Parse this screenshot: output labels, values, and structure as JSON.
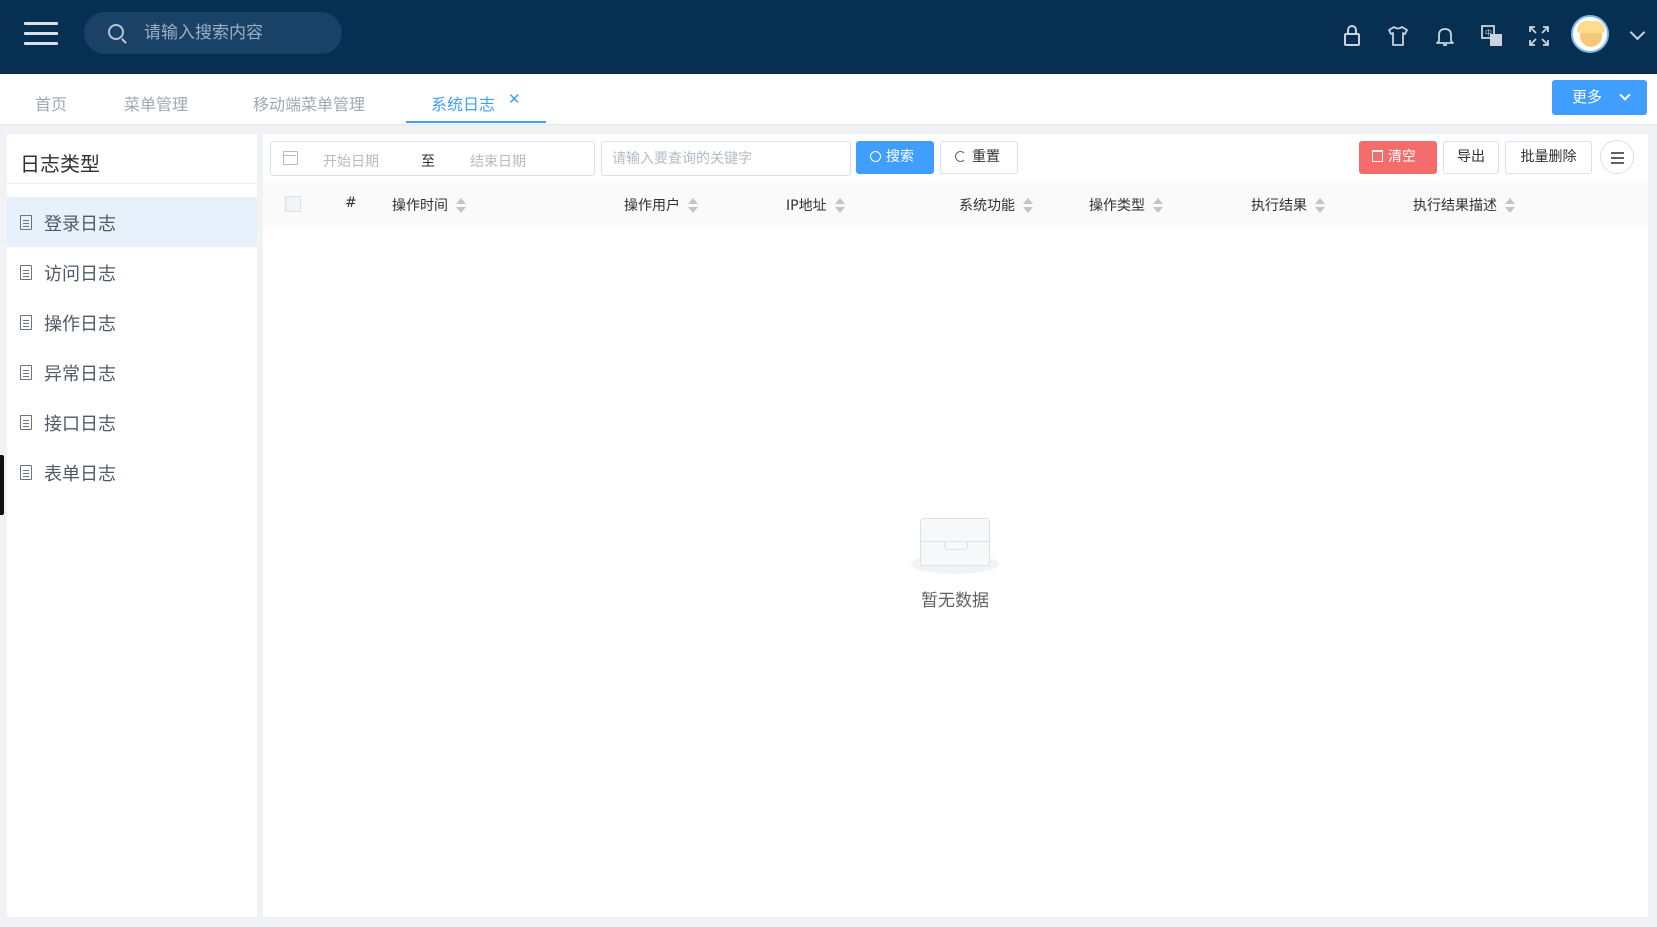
{
  "header": {
    "search_placeholder": "请输入搜索内容",
    "icons": [
      "menu-icon",
      "search-icon",
      "lock-icon",
      "shirt-icon",
      "bell-icon",
      "translate-icon",
      "fullscreen-icon",
      "avatar",
      "chevron-down-icon"
    ]
  },
  "tabs": {
    "items": [
      {
        "label": "首页",
        "active": false
      },
      {
        "label": "菜单管理",
        "active": false
      },
      {
        "label": "移动端菜单管理",
        "active": false
      },
      {
        "label": "系统日志",
        "active": true
      }
    ],
    "more_label": "更多"
  },
  "sidebar": {
    "title": "日志类型",
    "items": [
      {
        "label": "登录日志",
        "active": true
      },
      {
        "label": "访问日志",
        "active": false
      },
      {
        "label": "操作日志",
        "active": false
      },
      {
        "label": "异常日志",
        "active": false
      },
      {
        "label": "接口日志",
        "active": false
      },
      {
        "label": "表单日志",
        "active": false
      }
    ]
  },
  "toolbar": {
    "start_placeholder": "开始日期",
    "to": "至",
    "end_placeholder": "结束日期",
    "keyword_placeholder": "请输入要查询的关键字",
    "search_label": "搜索",
    "reset_label": "重置",
    "clear_label": "清空",
    "export_label": "导出",
    "bulk_delete_label": "批量删除"
  },
  "table": {
    "columns": [
      "#",
      "操作时间",
      "操作用户",
      "IP地址",
      "系统功能",
      "操作类型",
      "执行结果",
      "执行结果描述"
    ],
    "rows": [],
    "empty_text": "暂无数据"
  },
  "colors": {
    "header_bg": "#062f51",
    "primary": "#409eff",
    "danger": "#f56c6c"
  }
}
